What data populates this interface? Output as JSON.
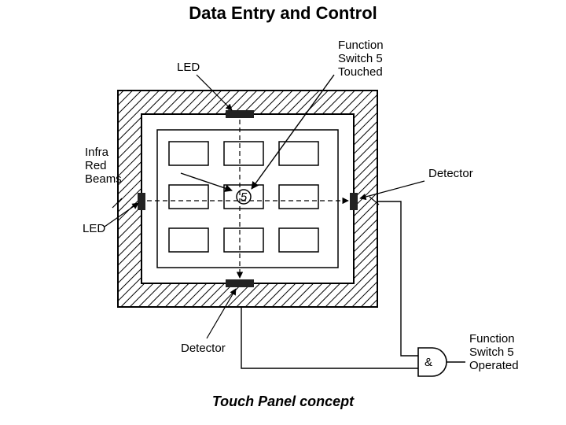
{
  "title": "Data Entry and Control",
  "caption": "Touch Panel concept",
  "labels": {
    "led_top": "LED",
    "function_touched_l1": "Function",
    "function_touched_l2": "Switch 5",
    "function_touched_l3": "Touched",
    "infrared_l1": "Infra",
    "infrared_l2": "Red",
    "infrared_l3": "Beams",
    "detector_right": "Detector",
    "led_left": "LED",
    "detector_bottom": "Detector",
    "function_operated_l1": "Function",
    "function_operated_l2": "Switch 5",
    "function_operated_l3": "Operated",
    "center_key": "5",
    "and_gate": "&"
  }
}
